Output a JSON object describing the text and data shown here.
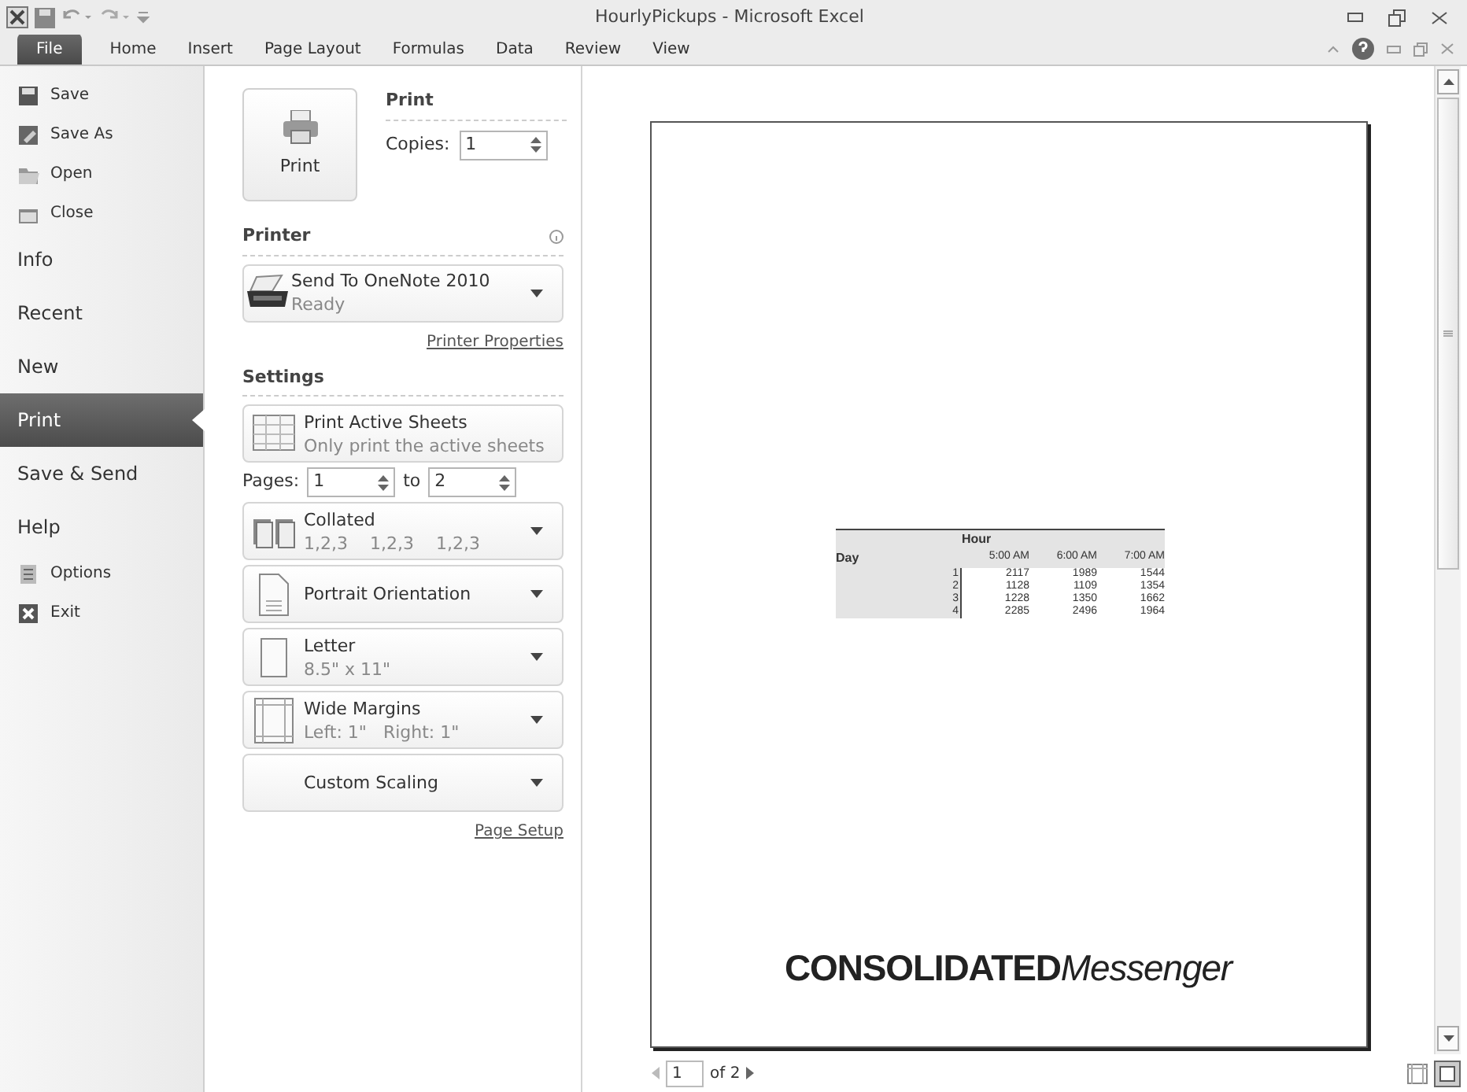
{
  "window": {
    "title": "HourlyPickups - Microsoft Excel"
  },
  "ribbon_tabs": [
    {
      "label": "File",
      "selected": true
    },
    {
      "label": "Home",
      "selected": false
    },
    {
      "label": "Insert",
      "selected": false
    },
    {
      "label": "Page Layout",
      "selected": false
    },
    {
      "label": "Formulas",
      "selected": false
    },
    {
      "label": "Data",
      "selected": false
    },
    {
      "label": "Review",
      "selected": false
    },
    {
      "label": "View",
      "selected": false
    }
  ],
  "backstage_nav": [
    {
      "label": "Save",
      "kind": "command",
      "selected": false
    },
    {
      "label": "Save As",
      "kind": "command",
      "selected": false
    },
    {
      "label": "Open",
      "kind": "command",
      "selected": false
    },
    {
      "label": "Close",
      "kind": "command",
      "selected": false
    },
    {
      "label": "Info",
      "kind": "section",
      "selected": false
    },
    {
      "label": "Recent",
      "kind": "section",
      "selected": false
    },
    {
      "label": "New",
      "kind": "section",
      "selected": false
    },
    {
      "label": "Print",
      "kind": "section",
      "selected": true
    },
    {
      "label": "Save & Send",
      "kind": "section",
      "selected": false
    },
    {
      "label": "Help",
      "kind": "section",
      "selected": false
    },
    {
      "label": "Options",
      "kind": "command",
      "selected": false
    },
    {
      "label": "Exit",
      "kind": "command",
      "selected": false
    }
  ],
  "print": {
    "button": "Print",
    "heading": "Print",
    "copies_label": "Copies:",
    "copies": "1"
  },
  "printer": {
    "heading": "Printer",
    "name": "Send To OneNote 2010",
    "status": "Ready",
    "properties_link": "Printer Properties"
  },
  "settings": {
    "heading": "Settings",
    "scope": {
      "title": "Print Active Sheets",
      "subtitle": "Only print the active sheets",
      "kind": "sheets"
    },
    "pages": {
      "label": "Pages:",
      "from": "1",
      "to_label": "to",
      "to": "2"
    },
    "options": [
      {
        "title": "Collated",
        "subtitle": "1,2,3    1,2,3    1,2,3",
        "kind": "collated"
      },
      {
        "title": "Portrait Orientation",
        "kind": "portrait"
      },
      {
        "title": "Letter",
        "subtitle": "8.5\" x 11\"",
        "kind": "paper"
      },
      {
        "title": "Wide Margins",
        "subtitle": "Left: 1\"   Right: 1\"",
        "kind": "margins"
      },
      {
        "title": "Custom Scaling",
        "kind": "none"
      }
    ],
    "page_setup_link": "Page Setup"
  },
  "preview": {
    "table": {
      "header": "Hour",
      "row_header": "Day",
      "columns": [
        "5:00 AM",
        "6:00 AM",
        "7:00 AM"
      ],
      "rows": [
        {
          "day": "1",
          "values": [
            "2117",
            "1989",
            "1544"
          ]
        },
        {
          "day": "2",
          "values": [
            "1128",
            "1109",
            "1354"
          ]
        },
        {
          "day": "3",
          "values": [
            "1228",
            "1350",
            "1662"
          ]
        },
        {
          "day": "4",
          "values": [
            "2285",
            "2496",
            "1964"
          ]
        }
      ]
    },
    "logo": {
      "bold_part": "**CONSOLIDATED**",
      "italic_part": "*Messenger*"
    },
    "page_field": "1",
    "page_total": "of 2"
  }
}
